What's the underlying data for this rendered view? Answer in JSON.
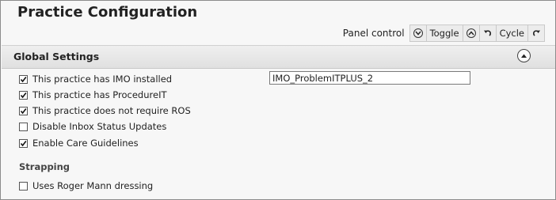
{
  "page": {
    "title": "Practice Configuration"
  },
  "panel_control": {
    "label": "Panel control",
    "toggle_label": "Toggle",
    "cycle_label": "Cycle"
  },
  "global_settings": {
    "title": "Global Settings",
    "options": [
      {
        "label": "This practice has IMO installed",
        "checked": true
      },
      {
        "label": "This practice has ProcedureIT",
        "checked": true
      },
      {
        "label": "This practice does not require ROS",
        "checked": true
      },
      {
        "label": "Disable Inbox Status Updates",
        "checked": false
      },
      {
        "label": "Enable Care Guidelines",
        "checked": true
      }
    ],
    "imo_input_value": "IMO_ProblemITPLUS_2"
  },
  "strapping": {
    "title": "Strapping",
    "options": [
      {
        "label": "Uses Roger Mann dressing",
        "checked": false
      }
    ]
  }
}
